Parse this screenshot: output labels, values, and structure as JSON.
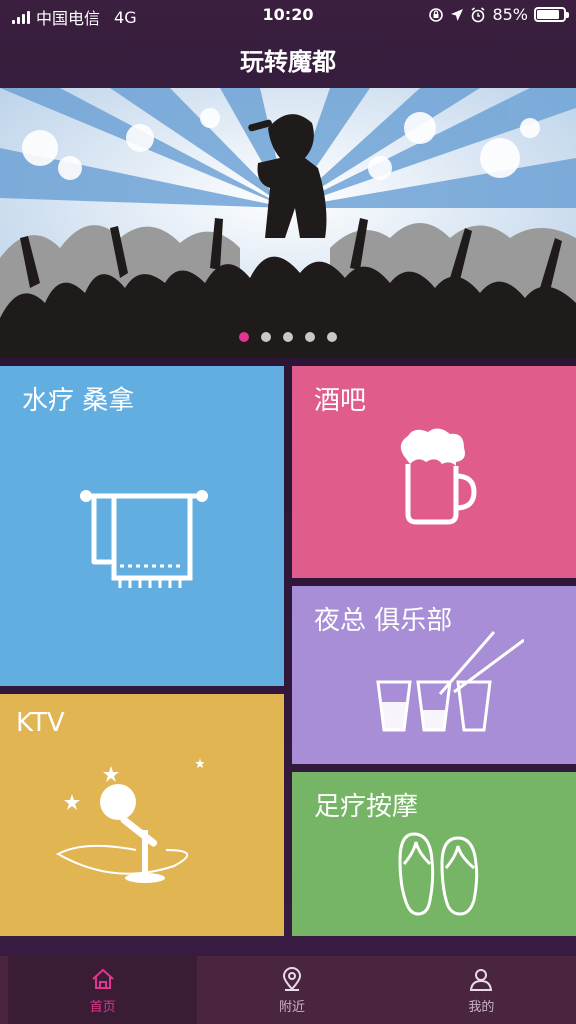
{
  "status": {
    "carrier": "中国电信",
    "network": "4G",
    "time": "10:20",
    "battery": "85%",
    "battery_level": 0.85
  },
  "header": {
    "title": "玩转魔都"
  },
  "banner": {
    "slide_count": 5,
    "active_slide": 1
  },
  "tiles": [
    {
      "label": "水疗 桑拿",
      "icon": "towel-icon",
      "color": "#62aee0"
    },
    {
      "label": "酒吧",
      "icon": "beer-mug-icon",
      "color": "#e05c8d"
    },
    {
      "label": "夜总 俱乐部",
      "icon": "shot-glasses-icon",
      "color": "#a88ed6"
    },
    {
      "label": "KTV",
      "icon": "microphone-icon",
      "color": "#e2b553"
    },
    {
      "label": "足疗按摩",
      "icon": "flip-flops-icon",
      "color": "#77b566"
    }
  ],
  "tabs": [
    {
      "label": "首页",
      "icon": "home-icon",
      "active": true
    },
    {
      "label": "附近",
      "icon": "location-pin-icon",
      "active": false
    },
    {
      "label": "我的",
      "icon": "user-icon",
      "active": false
    }
  ]
}
